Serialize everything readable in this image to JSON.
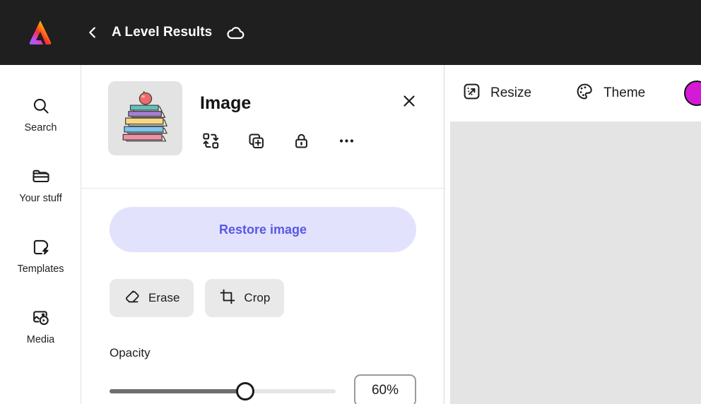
{
  "app": {
    "name": "Adobe Express",
    "logo_icon": "adobe-express-logo"
  },
  "topbar": {
    "back_icon": "chevron-left-icon",
    "title": "A Level Results",
    "cloud_icon": "cloud-saved-icon"
  },
  "sidebar": {
    "items": [
      {
        "label": "Search",
        "icon": "search-icon"
      },
      {
        "label": "Your stuff",
        "icon": "folder-icon"
      },
      {
        "label": "Templates",
        "icon": "templates-icon"
      },
      {
        "label": "Media",
        "icon": "media-icon"
      }
    ]
  },
  "panel": {
    "object_type": "Image",
    "thumbnail_icon": "book-stack-with-apple-thumbnail",
    "close_icon": "close-icon",
    "object_tools": [
      {
        "name": "replace-media",
        "icon": "replace-media-icon"
      },
      {
        "name": "duplicate",
        "icon": "add-layer-icon"
      },
      {
        "name": "lock",
        "icon": "lock-icon"
      },
      {
        "name": "more-options",
        "icon": "more-options-icon"
      }
    ],
    "restore_label": "Restore image",
    "edit_buttons": [
      {
        "label": "Erase",
        "icon": "eraser-icon"
      },
      {
        "label": "Crop",
        "icon": "crop-icon"
      }
    ],
    "opacity": {
      "label": "Opacity",
      "value": "60%",
      "percent": 60
    }
  },
  "toolbar": {
    "items": [
      {
        "label": "Resize",
        "icon": "resize-icon"
      },
      {
        "label": "Theme",
        "icon": "palette-icon"
      }
    ],
    "avatar_icon": "user-avatar"
  },
  "colors": {
    "topbar_bg": "#1f1f1f",
    "accent_blue": "#5858e3",
    "accent_blue_bg": "#e2e2fd",
    "canvas_bg": "#e4e4e4",
    "button_bg": "#e9e9e9",
    "avatar": "#d41ad4"
  }
}
